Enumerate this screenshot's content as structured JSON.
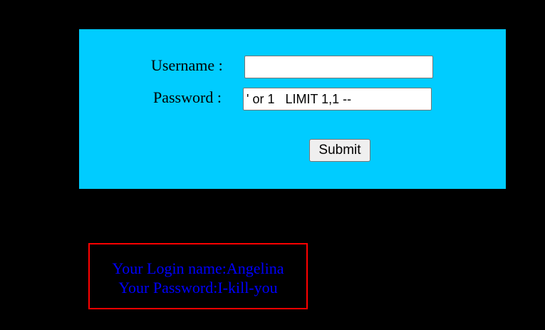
{
  "form": {
    "username_label": "Username :",
    "username_value": "",
    "password_label": "Password :",
    "password_value": "' or 1   LIMIT 1,1 --",
    "submit_label": "Submit"
  },
  "result": {
    "login_line": "Your Login name:Angelina",
    "password_line": "Your Password:I-kill-you"
  },
  "colors": {
    "page_background": "#000000",
    "panel_background": "#00CCFF",
    "result_text": "#0000FF",
    "result_border": "#FF0000"
  }
}
